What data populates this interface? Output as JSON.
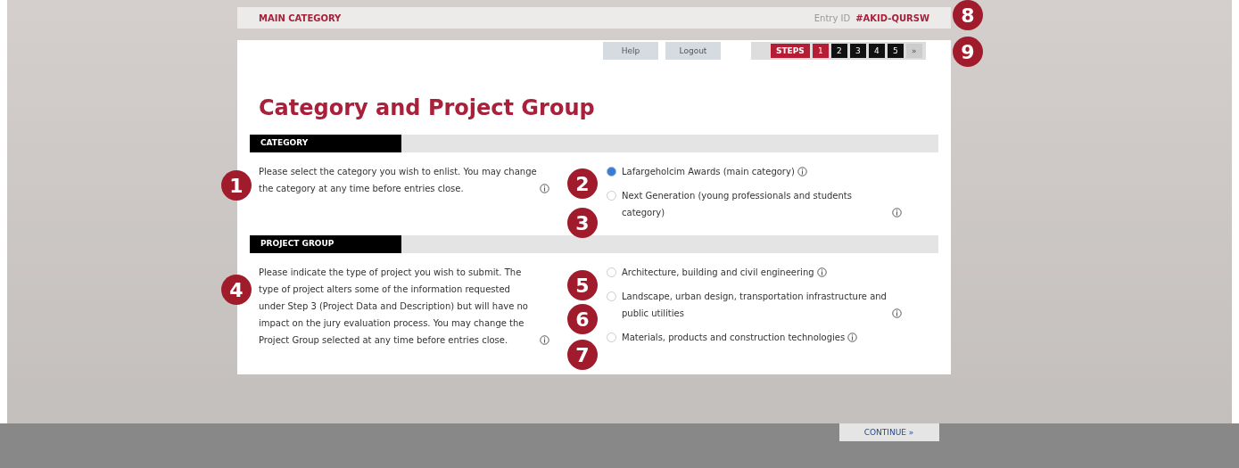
{
  "top_bar": {
    "title": "MAIN CATEGORY",
    "entry_label": "Entry ID",
    "entry_id": "#AKID-QURSW"
  },
  "toolbar": {
    "buttons": [
      "Help",
      "Logout"
    ],
    "steps_label": "STEPS",
    "steps": [
      {
        "label": "1",
        "selected": true
      },
      {
        "label": "2",
        "selected": false
      },
      {
        "label": "3",
        "selected": false
      },
      {
        "label": "4",
        "selected": false
      },
      {
        "label": "5",
        "selected": false
      }
    ],
    "next": "»"
  },
  "page_title": "Category and Project Group",
  "sections": [
    {
      "heading": "CATEGORY",
      "description": "Please select the category you wish to enlist. You may change the category at any time before entries close.",
      "options": [
        {
          "label": "Lafargeholcim Awards (main category)",
          "selected": true
        },
        {
          "label": "Next Generation (young professionals and students category)",
          "selected": false
        }
      ]
    },
    {
      "heading": "PROJECT GROUP",
      "description": "Please indicate the type of project you wish to submit. The type of project alters some of the information requested under Step 3 (Project Data and Description) but will have no impact on the jury evaluation process. You may change the Project Group selected at any time before entries close.",
      "options": [
        {
          "label": "Architecture, building and civil engineering",
          "selected": false
        },
        {
          "label": "Landscape, urban design, transportation infrastructure and public utilities",
          "selected": false
        },
        {
          "label": "Materials, products and construction technologies",
          "selected": false
        }
      ]
    }
  ],
  "continue_button": "CONTINUE »",
  "callouts": [
    "1",
    "2",
    "3",
    "4",
    "5",
    "6",
    "7",
    "8",
    "9"
  ]
}
